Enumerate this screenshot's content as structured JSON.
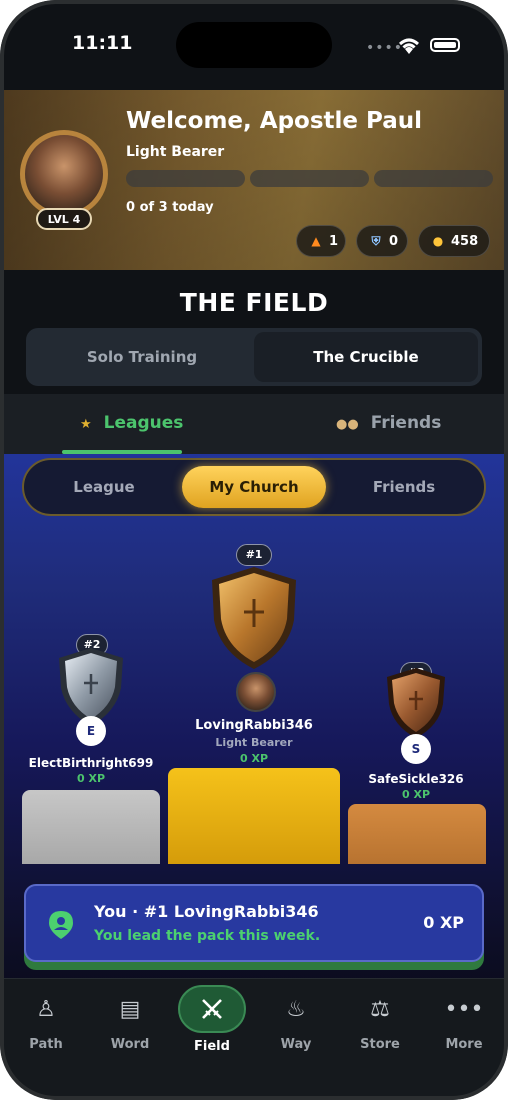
{
  "status_bar": {
    "time": "11:11"
  },
  "header": {
    "welcome": "Welcome, Apostle Paul",
    "rank": "Light Bearer",
    "level": "LVL 4",
    "progress_today": "0 of 3 today",
    "stats": {
      "streak": "1",
      "shields": "0",
      "coins": "458"
    }
  },
  "page_title": "THE FIELD",
  "mode_tabs": {
    "solo": "Solo Training",
    "crucible": "The Crucible",
    "selected": "The Crucible"
  },
  "section_tabs": {
    "leagues": "Leagues",
    "friends": "Friends",
    "selected": "Leagues"
  },
  "scope_tabs": {
    "league": "League",
    "my_church": "My Church",
    "friends": "Friends",
    "selected": "My Church"
  },
  "podium": {
    "first": {
      "rank": "#1",
      "name": "LovingRabbi346",
      "title": "Light Bearer",
      "xp": "0 XP"
    },
    "second": {
      "rank": "#2",
      "initial": "E",
      "name": "ElectBirthright699",
      "xp": "0 XP"
    },
    "third": {
      "rank": "#3",
      "initial": "S",
      "name": "SafeSickle326",
      "xp": "0 XP"
    }
  },
  "you_banner": {
    "line1": "You · #1 LovingRabbi346",
    "line2": "You lead the pack this week.",
    "xp": "0 XP"
  },
  "bottom_nav": {
    "items": [
      {
        "label": "Path"
      },
      {
        "label": "Word"
      },
      {
        "label": "Field"
      },
      {
        "label": "Way"
      },
      {
        "label": "Store"
      },
      {
        "label": "More"
      }
    ],
    "selected": "Field"
  }
}
